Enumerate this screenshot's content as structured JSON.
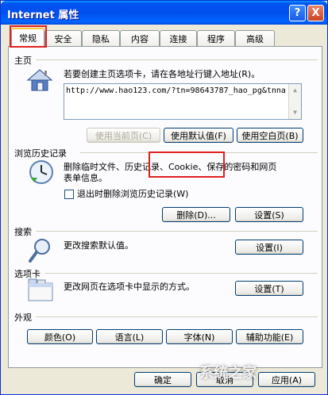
{
  "window": {
    "title": "Internet 属性",
    "help_label": "?",
    "close_label": "X"
  },
  "tabs": [
    {
      "label": "常规"
    },
    {
      "label": "安全"
    },
    {
      "label": "隐私"
    },
    {
      "label": "内容"
    },
    {
      "label": "连接"
    },
    {
      "label": "程序"
    },
    {
      "label": "高级"
    }
  ],
  "homepage": {
    "title": "主页",
    "description": "若要创建主页选项卡，请在各地址行键入地址(R)。",
    "url": "http://www.hao123.com/?tn=98643787_hao_pg&tnna",
    "use_current_label": "使用当前页(C)",
    "use_default_label": "使用默认值(F)",
    "use_blank_label": "使用空白页(B)"
  },
  "history": {
    "title": "浏览历史记录",
    "description_line1": "删除临时文件、历史记录、Cookie、保存的密码和网页",
    "description_line2": "表单信息。",
    "checkbox_label": "退出时删除浏览历史记录(W)",
    "delete_label": "删除(D)...",
    "settings_label": "设置(S)"
  },
  "search": {
    "title": "搜索",
    "description": "更改搜索默认值。",
    "settings_label": "设置(I)"
  },
  "tabs_section": {
    "title": "选项卡",
    "description": "更改网页在选项卡中显示的方式。",
    "settings_label": "设置(T)"
  },
  "appearance": {
    "title": "外观",
    "colors_label": "颜色(O)",
    "languages_label": "语言(L)",
    "fonts_label": "字体(N)",
    "accessibility_label": "辅助功能(E)"
  },
  "footer": {
    "ok_label": "确定",
    "cancel_label": "取消",
    "apply_label": "应用(A)"
  },
  "watermark": {
    "text": "系统之家"
  },
  "colors": {
    "highlight": "#e02020",
    "titlebar": "#0053ee"
  }
}
